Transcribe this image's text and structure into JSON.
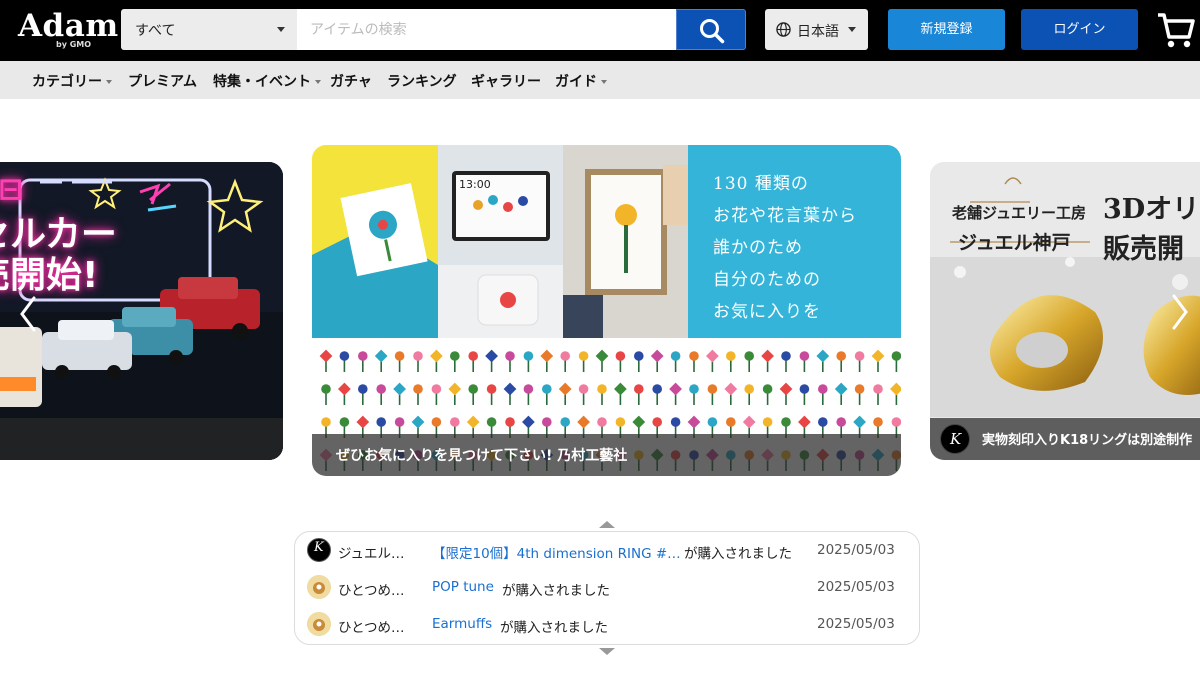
{
  "header": {
    "logo": {
      "text": "Adam",
      "byline": "by GMO"
    },
    "search": {
      "category": "すべて",
      "placeholder": "アイテムの検索"
    },
    "language": "日本語",
    "signup_label": "新規登録",
    "login_label": "ログイン"
  },
  "nav": {
    "items": [
      {
        "label": "カテゴリー",
        "dropdown": true
      },
      {
        "label": "プレミアム",
        "dropdown": false
      },
      {
        "label": "特集・イベント",
        "dropdown": true
      },
      {
        "label": "ガチャ",
        "dropdown": false
      },
      {
        "label": "ランキング",
        "dropdown": false
      },
      {
        "label": "ギャラリー",
        "dropdown": false
      },
      {
        "label": "ガイド",
        "dropdown": true
      }
    ]
  },
  "carousel": {
    "left": {
      "art_lines": [
        "セルカー",
        "売開始!"
      ]
    },
    "center": {
      "caption": "ぜひお気に入りを見つけて下さい! 乃村工藝社",
      "copy_lines": [
        "130 種類の",
        "お花や花言葉から",
        "誰かのため",
        "自分のための",
        "お気に入りを"
      ],
      "clock": "13:00"
    },
    "right": {
      "caption": "実物刻印入りK18リングは別途制作",
      "title_small": "老舗ジュエリー工房",
      "title_name": "ジュエル神戸",
      "title_big_1": "3Dオリ",
      "title_big_2": "販売開"
    }
  },
  "purchase_feed": {
    "rows": [
      {
        "user": "ジュエル…",
        "item": "【限定10個】4th dimension RING #…",
        "action": "が購入されました",
        "date": "2025/05/03",
        "avatar": "k"
      },
      {
        "user": "ひとつめ…",
        "item": "POP tune",
        "action": "が購入されました",
        "date": "2025/05/03",
        "avatar": "c"
      },
      {
        "user": "ひとつめ…",
        "item": "Earmuffs",
        "action": "が購入されました",
        "date": "2025/05/03",
        "avatar": "c"
      }
    ]
  },
  "colors": {
    "header_bg": "#000000",
    "search_button": "#0c52b4",
    "signup_button": "#1a86d8",
    "login_button": "#0c52b4",
    "link_blue": "#1a6fd0",
    "banner_cyan": "#33b4d8"
  }
}
